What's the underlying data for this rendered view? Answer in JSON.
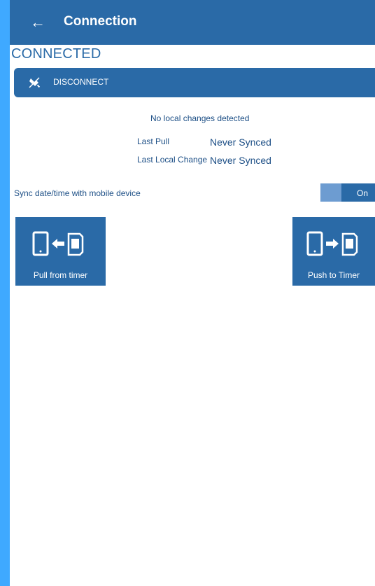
{
  "appbar": {
    "back_icon": "←",
    "title": "Connection"
  },
  "status": {
    "text": "CONNECTED"
  },
  "disconnect": {
    "label": "DISCONNECT",
    "icon": "unplug-icon"
  },
  "sync": {
    "message": "No local changes detected",
    "last_pull_label": "Last Pull",
    "last_pull_value": "Never Synced",
    "last_local_change_label": "Last Local Change",
    "last_local_change_value": "Never Synced"
  },
  "sync_datetime": {
    "label": "Sync date/time with mobile device",
    "toggle_text": "On",
    "state": "on"
  },
  "actions": {
    "pull": {
      "label": "Pull from timer",
      "icon": "pull-from-timer-icon"
    },
    "push": {
      "label": "Push to Timer",
      "icon": "push-to-timer-icon"
    }
  },
  "colors": {
    "primary": "#2a6aa7",
    "frame_border": "#3fa9ff",
    "text": "#1d4f86"
  }
}
